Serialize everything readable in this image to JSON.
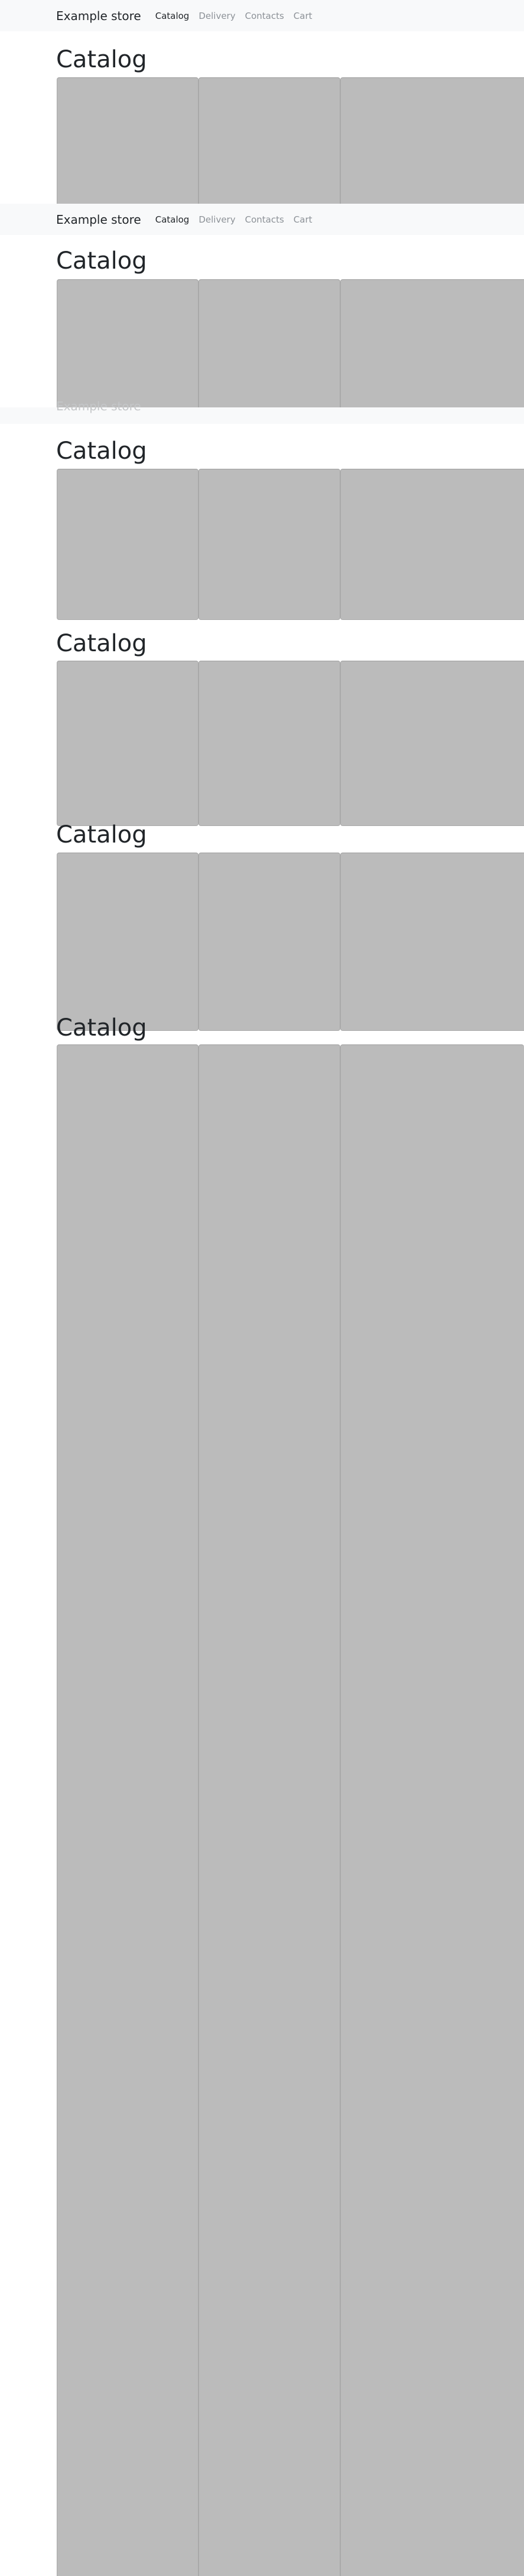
{
  "navbar": {
    "brand": "Example store",
    "links": [
      {
        "label": "Catalog",
        "active": true
      },
      {
        "label": "Delivery",
        "active": false
      },
      {
        "label": "Contacts",
        "active": false
      },
      {
        "label": "Cart",
        "active": false
      }
    ]
  },
  "catalog": {
    "heading": "Catalog"
  },
  "colors": {
    "navbar_bg": "#f8f9fa",
    "tile_bg": "#bbbbbb",
    "link_active": "#212529",
    "link_muted": "#8c9197"
  }
}
